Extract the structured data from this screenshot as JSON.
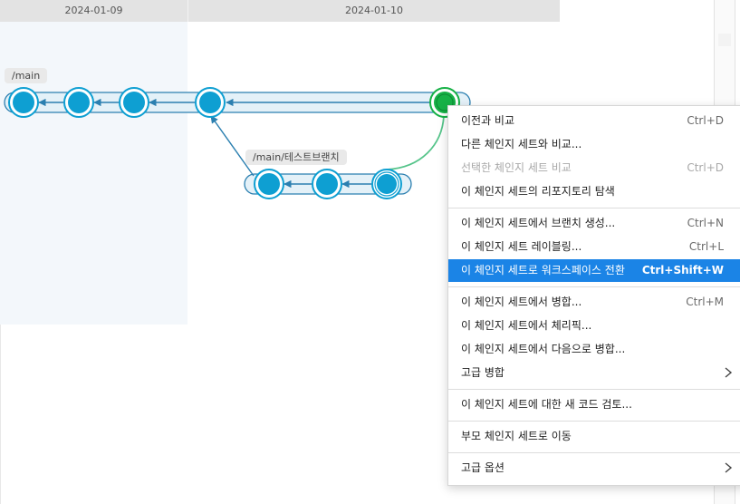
{
  "dates": [
    "2024-01-09",
    "2024-01-10"
  ],
  "branches": {
    "main": "/main",
    "test": "/main/테스트브랜치"
  },
  "colors": {
    "node": "#0e9fd2",
    "selected_node": "#16b146",
    "highlight": "#1b84e6"
  },
  "menu": {
    "compare_previous": {
      "label": "이전과 비교",
      "shortcut": "Ctrl+D"
    },
    "compare_other": {
      "label": "다른 체인지 세트와 비교..."
    },
    "compare_selected": {
      "label": "선택한 체인지 세트 비교",
      "shortcut": "Ctrl+D"
    },
    "explore_repo": {
      "label": "이 체인지 세트의 리포지토리 탐색"
    },
    "create_branch": {
      "label": "이 체인지 세트에서 브랜치 생성...",
      "shortcut": "Ctrl+N"
    },
    "label_cs": {
      "label": "이 체인지 세트 레이블링...",
      "shortcut": "Ctrl+L"
    },
    "switch_workspace": {
      "label": "이 체인지 세트로 워크스페이스 전환",
      "shortcut": "Ctrl+Shift+W"
    },
    "merge_from": {
      "label": "이 체인지 세트에서 병합...",
      "shortcut": "Ctrl+M"
    },
    "cherry_pick": {
      "label": "이 체인지 세트에서 체리픽..."
    },
    "merge_to": {
      "label": "이 체인지 세트에서 다음으로 병합..."
    },
    "advanced_merge": {
      "label": "고급 병합"
    },
    "code_review": {
      "label": "이 체인지 세트에 대한 새 코드 검토..."
    },
    "go_parent": {
      "label": "부모 체인지 세트로 이동"
    },
    "advanced_options": {
      "label": "고급 옵션"
    }
  }
}
